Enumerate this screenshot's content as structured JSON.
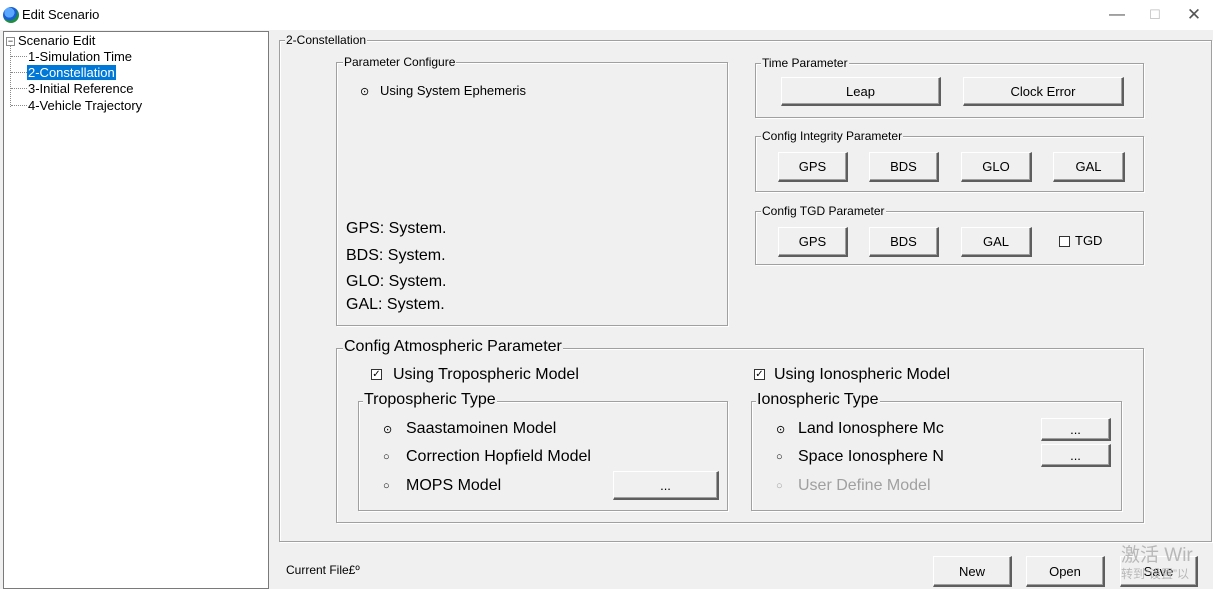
{
  "window": {
    "title": "Edit Scenario",
    "minimize_glyph": "—",
    "maximize_glyph": "☐",
    "close_glyph": "✕"
  },
  "tree": {
    "root": "Scenario Edit",
    "expander": "⊟",
    "items": [
      "1-Simulation Time",
      "2-Constellation",
      "3-Initial Reference",
      "4-Vehicle Trajectory"
    ],
    "selected": "2-Constellation"
  },
  "panel": {
    "title": "2-Constellation"
  },
  "parameter_configure": {
    "title": "Parameter Configure",
    "radio_label": "Using System Ephemeris",
    "status": [
      "GPS: System.",
      "BDS: System.",
      "GLO: System.",
      "GAL: System."
    ]
  },
  "time_parameter": {
    "title": "Time Parameter",
    "leap": "Leap",
    "clock_error": "Clock Error"
  },
  "integrity": {
    "title": "Config Integrity Parameter",
    "gps": "GPS",
    "bds": "BDS",
    "glo": "GLO",
    "gal": "GAL"
  },
  "tgd": {
    "title": "Config TGD Parameter",
    "gps": "GPS",
    "bds": "BDS",
    "gal": "GAL",
    "tgd_label": "TGD"
  },
  "atmospheric": {
    "title": "Config Atmospheric Parameter",
    "use_tropo": "Using Tropospheric Model",
    "use_iono": "Using Ionospheric  Model",
    "tropo_type": {
      "title": "Tropospheric Type",
      "saastamoinen": "Saastamoinen Model",
      "hopfield": "Correction Hopfield Model",
      "mops": "MOPS Model",
      "ellipsis": "..."
    },
    "iono_type": {
      "title": "Ionospheric Type",
      "land": "Land Ionosphere Mc",
      "space": "Space Ionosphere N",
      "user": "User Define Model",
      "ellipsis": "..."
    }
  },
  "footer": {
    "current_file": "Current File£º",
    "new": "New",
    "open": "Open",
    "save": "Save"
  },
  "watermark": {
    "line1": "激活 Wir",
    "line2": "转到“设置”以"
  },
  "glyphs": {
    "radio_on": "•",
    "check_on": "✓"
  }
}
